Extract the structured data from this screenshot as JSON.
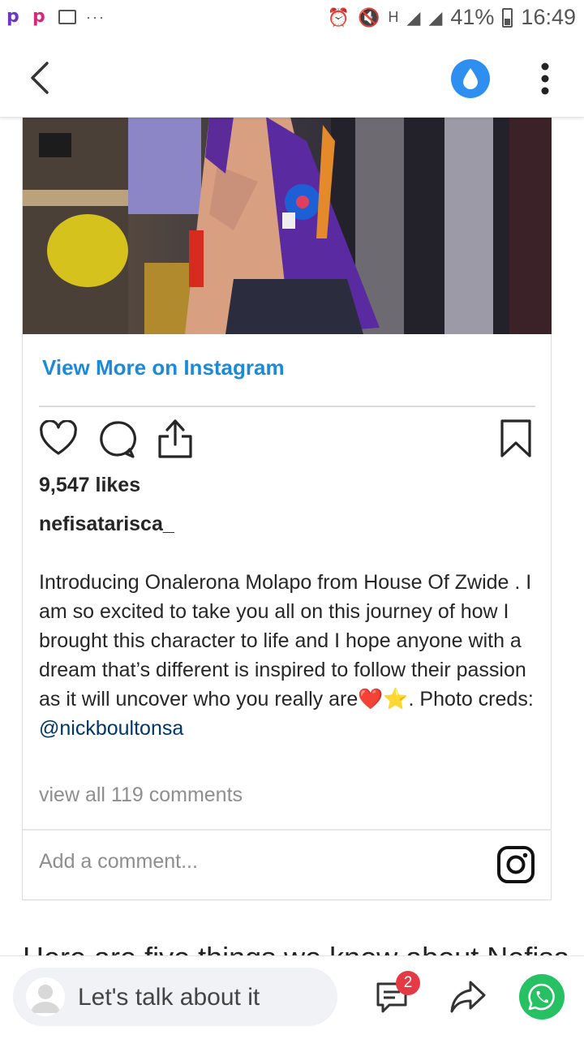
{
  "status_bar": {
    "battery": "41%",
    "time": "16:49",
    "notification_icons": [
      "p-app-icon",
      "p-app-icon",
      "image-icon",
      "more-dots-icon"
    ],
    "system_icons": [
      "alarm-icon",
      "mute-icon",
      "clock-icon",
      "sync-icon",
      "h-signal-icon",
      "signal-icon",
      "battery-icon"
    ]
  },
  "app_bar": {
    "back_icon": "chevron-left-icon",
    "action_icon": "water-drop-icon",
    "menu_icon": "vertical-dots-icon",
    "accent": "#2f8ff0"
  },
  "embed": {
    "view_more": "View More on Instagram",
    "likes": "9,547 likes",
    "username": "nefisatarisca_",
    "caption_text": "Introducing Onalerona Molapo from House Of Zwide . I am so excited to take you all on this journey of how I brought this character to life and I hope anyone with a dream that’s different is inspired to follow their passion as it will uncover who you really are",
    "caption_emoji_heart": "❤️",
    "caption_emoji_star": "⭐",
    "caption_tail": ". Photo creds: ",
    "mention": "@nickboultonsa",
    "comments_link": "view all 119 comments",
    "add_comment_placeholder": "Add a comment...",
    "link_color": "#1d8ad9"
  },
  "article": {
    "partial_text": "Here are five things we know about Nefisa"
  },
  "bottom_bar": {
    "comment_prompt": "Let's talk about it",
    "comment_count": "2",
    "whatsapp_color": "#25c163"
  }
}
